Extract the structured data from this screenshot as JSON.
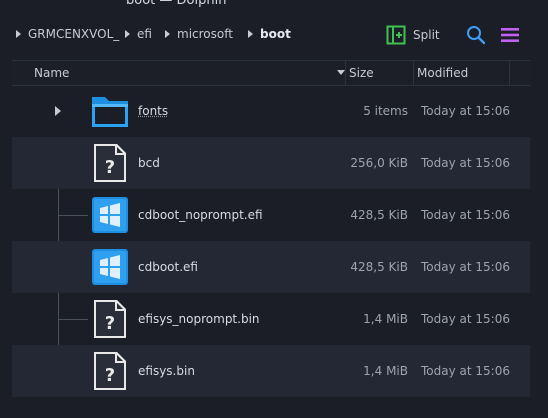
{
  "window": {
    "title": "boot — Dolphin"
  },
  "breadcrumbs": [
    {
      "label": "GRMCENXVOL_"
    },
    {
      "label": "efi"
    },
    {
      "label": "microsoft"
    },
    {
      "label": "boot"
    }
  ],
  "toolbar": {
    "split_label": "Split",
    "split_icon": "split-view-icon",
    "search_icon": "search-icon",
    "menu_icon": "hamburger-menu-icon",
    "accent_green": "#3fc24f",
    "accent_blue": "#3d9ef5",
    "accent_purple": "#c061f0"
  },
  "columns": {
    "name": "Name",
    "size": "Size",
    "modified": "Modified"
  },
  "files": [
    {
      "name": "fonts",
      "size": "5 items",
      "modified": "Today at 15:06",
      "icon": "folder-icon"
    },
    {
      "name": "bcd",
      "size": "256,0 KiB",
      "modified": "Today at 15:06",
      "icon": "unknown-file-icon"
    },
    {
      "name": "cdboot_noprompt.efi",
      "size": "428,5 KiB",
      "modified": "Today at 15:06",
      "icon": "windows-executable-icon"
    },
    {
      "name": "cdboot.efi",
      "size": "428,5 KiB",
      "modified": "Today at 15:06",
      "icon": "windows-executable-icon"
    },
    {
      "name": "efisys_noprompt.bin",
      "size": "1,4 MiB",
      "modified": "Today at 15:06",
      "icon": "unknown-file-icon"
    },
    {
      "name": "efisys.bin",
      "size": "1,4 MiB",
      "modified": "Today at 15:06",
      "icon": "unknown-file-icon"
    }
  ]
}
